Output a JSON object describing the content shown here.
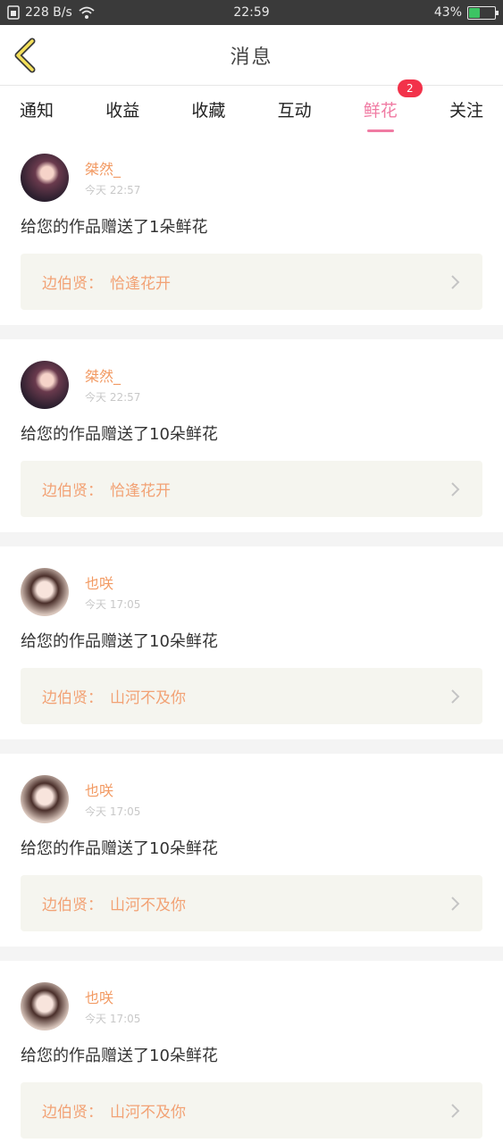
{
  "status_bar": {
    "speed": "228 B/s",
    "time": "22:59",
    "battery": "43%",
    "battery_level": 0.43
  },
  "header": {
    "title": "消息"
  },
  "tabs": [
    {
      "label": "通知"
    },
    {
      "label": "收益"
    },
    {
      "label": "收藏"
    },
    {
      "label": "互动"
    },
    {
      "label": "鲜花",
      "badge": "2",
      "active": true
    },
    {
      "label": "关注"
    }
  ],
  "items": [
    {
      "user": "桀然_",
      "time": "今天 22:57",
      "message": "给您的作品赠送了1朵鲜花",
      "work_prefix": "边伯贤：",
      "work_title": "恰逢花开"
    },
    {
      "user": "桀然_",
      "time": "今天 22:57",
      "message": "给您的作品赠送了10朵鲜花",
      "work_prefix": "边伯贤：",
      "work_title": "恰逢花开"
    },
    {
      "user": "也咲",
      "time": "今天 17:05",
      "message": "给您的作品赠送了10朵鲜花",
      "work_prefix": "边伯贤：",
      "work_title": "山河不及你"
    },
    {
      "user": "也咲",
      "time": "今天 17:05",
      "message": "给您的作品赠送了10朵鲜花",
      "work_prefix": "边伯贤：",
      "work_title": "山河不及你"
    },
    {
      "user": "也咲",
      "time": "今天 17:05",
      "message": "给您的作品赠送了10朵鲜花",
      "work_prefix": "边伯贤：",
      "work_title": "山河不及你"
    }
  ]
}
